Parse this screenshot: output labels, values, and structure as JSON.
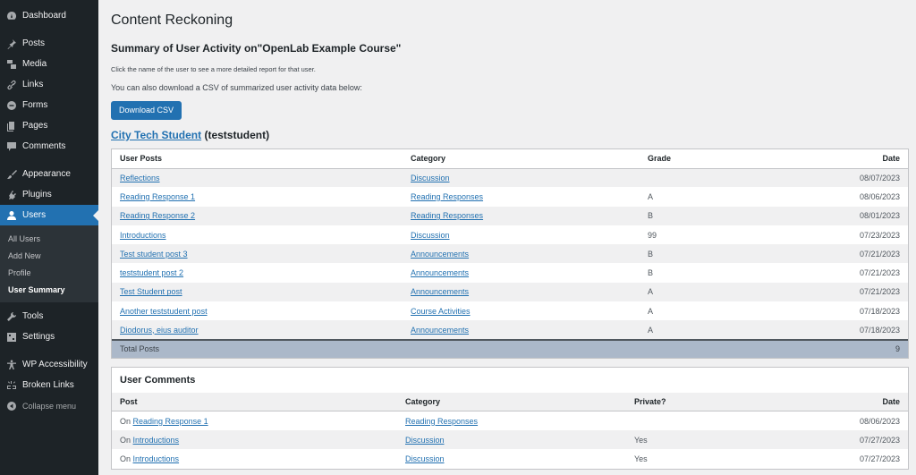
{
  "sidebar": {
    "items": [
      {
        "label": "Dashboard",
        "icon": "dashboard-icon"
      },
      {
        "label": "Posts",
        "icon": "pin-icon"
      },
      {
        "label": "Media",
        "icon": "media-icon"
      },
      {
        "label": "Links",
        "icon": "link-icon"
      },
      {
        "label": "Forms",
        "icon": "forms-icon"
      },
      {
        "label": "Pages",
        "icon": "pages-icon"
      },
      {
        "label": "Comments",
        "icon": "comment-icon"
      },
      {
        "label": "Appearance",
        "icon": "brush-icon"
      },
      {
        "label": "Plugins",
        "icon": "plugin-icon"
      },
      {
        "label": "Users",
        "icon": "user-icon"
      },
      {
        "label": "Tools",
        "icon": "wrench-icon"
      },
      {
        "label": "Settings",
        "icon": "settings-icon"
      },
      {
        "label": "WP Accessibility",
        "icon": "accessibility-icon"
      },
      {
        "label": "Broken Links",
        "icon": "broken-link-icon"
      },
      {
        "label": "Collapse menu",
        "icon": "collapse-icon"
      }
    ],
    "users_submenu": [
      "All Users",
      "Add New",
      "Profile",
      "User Summary"
    ]
  },
  "main": {
    "page_title": "Content Reckoning",
    "summary_title": "Summary of User Activity on\"OpenLab Example Course\"",
    "note": "Click the name of the user to see a more detailed report for that user.",
    "csv_note": "You can also download a CSV of summarized user activity data below:",
    "download_button": "Download CSV",
    "user_name": "City Tech Student",
    "user_login": "(teststudent)"
  },
  "posts_table": {
    "headers": [
      "User Posts",
      "Category",
      "Grade",
      "Date"
    ],
    "rows": [
      {
        "title": "Reflections",
        "category": "Discussion",
        "grade": "",
        "date": "08/07/2023"
      },
      {
        "title": "Reading Response 1",
        "category": "Reading Responses",
        "grade": "A",
        "date": "08/06/2023"
      },
      {
        "title": "Reading Response 2",
        "category": "Reading Responses",
        "grade": "B",
        "date": "08/01/2023"
      },
      {
        "title": "Introductions",
        "category": "Discussion",
        "grade": "99",
        "date": "07/23/2023"
      },
      {
        "title": "Test student post 3",
        "category": "Announcements",
        "grade": "B",
        "date": "07/21/2023"
      },
      {
        "title": "teststudent post 2",
        "category": "Announcements",
        "grade": "B",
        "date": "07/21/2023"
      },
      {
        "title": "Test Student post",
        "category": "Announcements",
        "grade": "A",
        "date": "07/21/2023"
      },
      {
        "title": "Another teststudent post",
        "category": "Course Activities",
        "grade": "A",
        "date": "07/18/2023"
      },
      {
        "title": "Diodorus, eius auditor",
        "category": "Announcements",
        "grade": "A",
        "date": "07/18/2023"
      }
    ],
    "total_label": "Total Posts",
    "total_value": "9"
  },
  "comments_table": {
    "title": "User Comments",
    "headers": [
      "Post",
      "Category",
      "Private?",
      "Date"
    ],
    "prefix": "On",
    "rows": [
      {
        "post": "Reading Response 1",
        "category": "Reading Responses",
        "private": "",
        "date": "08/06/2023"
      },
      {
        "post": "Introductions",
        "category": "Discussion",
        "private": "Yes",
        "date": "07/27/2023"
      },
      {
        "post": "Introductions",
        "category": "Discussion",
        "private": "Yes",
        "date": "07/27/2023"
      }
    ]
  }
}
